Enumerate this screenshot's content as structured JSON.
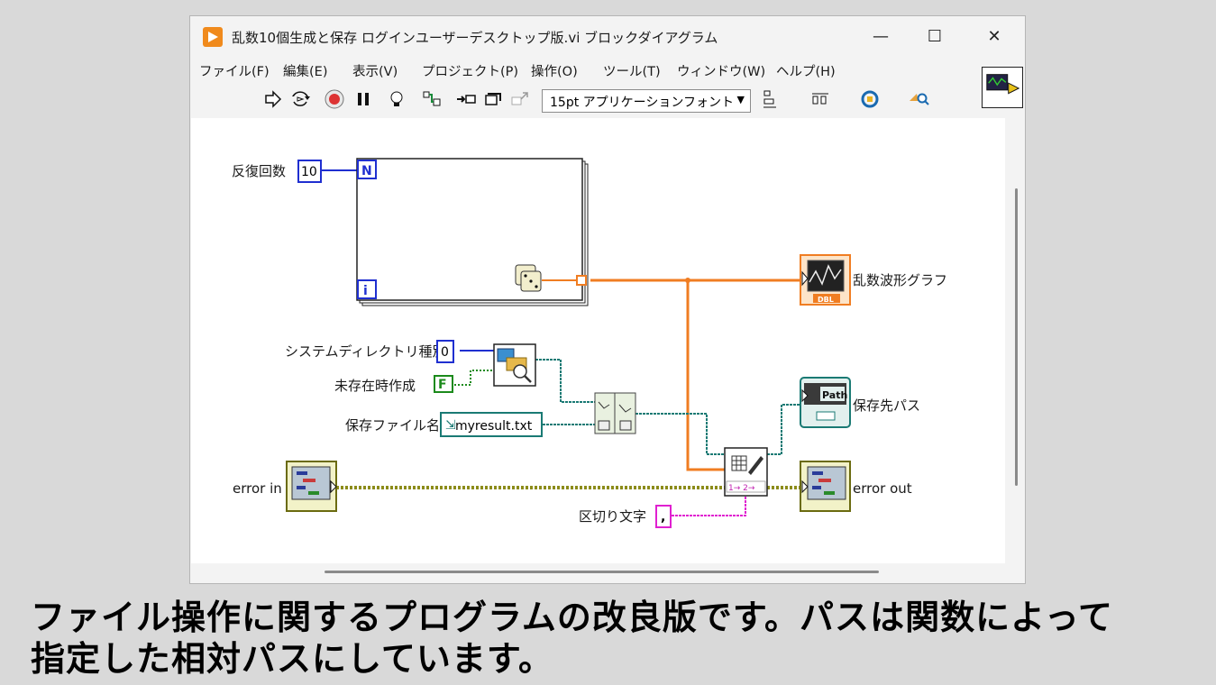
{
  "window": {
    "title": "乱数10個生成と保存 ログインユーザーデスクトップ版.vi ブロックダイアグラム",
    "controls": {
      "minimize": "—",
      "maximize": "☐",
      "close": "✕"
    }
  },
  "menu": [
    {
      "label": "ファイル(F)"
    },
    {
      "label": "編集(E)"
    },
    {
      "label": "表示(V)"
    },
    {
      "label": "プロジェクト(P)"
    },
    {
      "label": "操作(O)"
    },
    {
      "label": "ツール(T)"
    },
    {
      "label": "ウィンドウ(W)"
    },
    {
      "label": "ヘルプ(H)"
    }
  ],
  "toolbar": {
    "font_select": "15pt アプリケーションフォント",
    "icons": [
      "run-arrow-icon",
      "run-continuous-icon",
      "abort-icon",
      "pause-icon",
      "highlight-execution-icon",
      "retain-wire-values-icon",
      "step-into-icon",
      "step-over-icon",
      "step-out-icon",
      "align-icon",
      "distribute-icon",
      "reorder-icon",
      "cleanup-search-icon"
    ]
  },
  "diagram": {
    "loop_count_label": "反復回数",
    "loop_count_value": "10",
    "loop_N": "N",
    "loop_i": "i",
    "graph_label": "乱数波形グラフ",
    "graph_badge": "DBL",
    "dir_type_label": "システムディレクトリ種別",
    "dir_type_value": "0",
    "create_label": "未存在時作成",
    "create_value": "F",
    "filename_label": "保存ファイル名",
    "filename_value": "myresult.txt",
    "path_label": "保存先パス",
    "path_badge": "Path",
    "error_in_label": "error in",
    "error_out_label": "error out",
    "delimiter_label": "区切り文字",
    "delimiter_value": ",",
    "write_terms": "1→ 2→"
  },
  "caption": {
    "line1": "ファイル操作に関するプログラムの改良版です。パスは関数によって",
    "line2": "指定した相対パスにしています。"
  }
}
